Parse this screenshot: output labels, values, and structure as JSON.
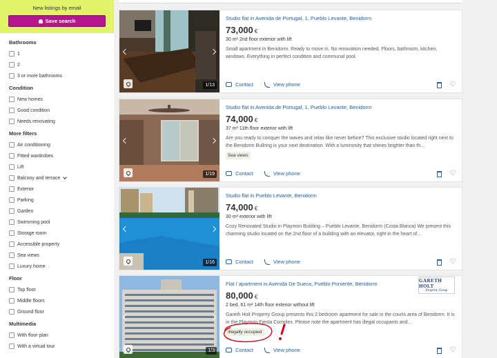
{
  "sidebar": {
    "alert_title": "New listings by email",
    "save_search_label": "Save search",
    "bathrooms": {
      "title": "Bathrooms",
      "options": [
        "1",
        "2",
        "3 or more bathrooms"
      ]
    },
    "condition": {
      "title": "Condition",
      "options": [
        "New homes",
        "Good condition",
        "Needs renovating"
      ]
    },
    "more_filters": {
      "title": "More filters",
      "options": [
        "Air conditioning",
        "Fitted wardrobes",
        "Lift",
        "Balcony and terrace",
        "Exterior",
        "Parking",
        "Garden",
        "Swimming pool",
        "Storage room",
        "Accessible property",
        "Sea views",
        "Luxury home"
      ]
    },
    "floor": {
      "title": "Floor",
      "options": [
        "Top floor",
        "Middle floors",
        "Ground floor"
      ]
    },
    "multimedia": {
      "title": "Multimedia",
      "options": [
        "With floor plan",
        "With a virtual tour"
      ]
    }
  },
  "listings": [
    {
      "title": "Studio flat in Avenida de Portugal, 1, Pueblo Levante, Benidorm",
      "price": "73,000",
      "currency": "€",
      "details": "30 m²  2nd floor exterior with lift",
      "description": "Small apartment in Benidorm. Ready to move in. No renovation needed. Floors, bathroom, kitchen, windows. Everything in perfect condition and communal pool.",
      "photo_counter": "1/13",
      "tag": "",
      "contact_label": "Contact",
      "phone_label": "View phone"
    },
    {
      "title": "Studio flat in Avenida de Portugal, 1, Pueblo Levante, Benidorm",
      "price": "74,000",
      "currency": "€",
      "details": "37 m²  11th floor exterior with lift",
      "description": "Are you ready to conquer the waves and relax like never before? This exclusive studio located right next to the Benidorm Bullring is your next destination. With a luminosity that shines brighter than th...",
      "photo_counter": "1/19",
      "tag": "Sea views",
      "contact_label": "Contact",
      "phone_label": "View phone"
    },
    {
      "title": "Studio flat in Pueblo Levante, Benidorm",
      "price": "74,000",
      "currency": "€",
      "details": "30 m²  exterior with lift",
      "description": "Cozy Renovated Studio in Playmon Building – Pueblo Levante, Benidorm (Costa Blanca) We present this charming studio located on the 2nd floor of a building with an elevator, right in the heart of...",
      "photo_counter": "1/16",
      "tag": "",
      "contact_label": "Contact",
      "phone_label": "View phone"
    },
    {
      "title": "Flat / apartment in Avenida De Sueca, Pueblo Poniente, Benidorm",
      "price": "80,000",
      "currency": "€",
      "details": "2 bed.  61 m²  14th floor exterior without lift",
      "description": "Gareth Holt Property Group presents this 2 bedroom apartment for sale in the courts area of Benidorm. It is in the Playmon Fiesta Complex. Please note the apartment has illegal occupants and...",
      "photo_counter": "1/3",
      "tag": "Illegally occupied",
      "contact_label": "Contact",
      "phone_label": "View phone",
      "agency_logo_line1": "GARETH HOLT",
      "agency_logo_line2": "Property Group"
    }
  ],
  "colors": {
    "alert_bg": "#e1f26b",
    "save_button": "#b5178b",
    "link_blue": "#1e5fa8",
    "annotation_red": "#d0021b"
  }
}
